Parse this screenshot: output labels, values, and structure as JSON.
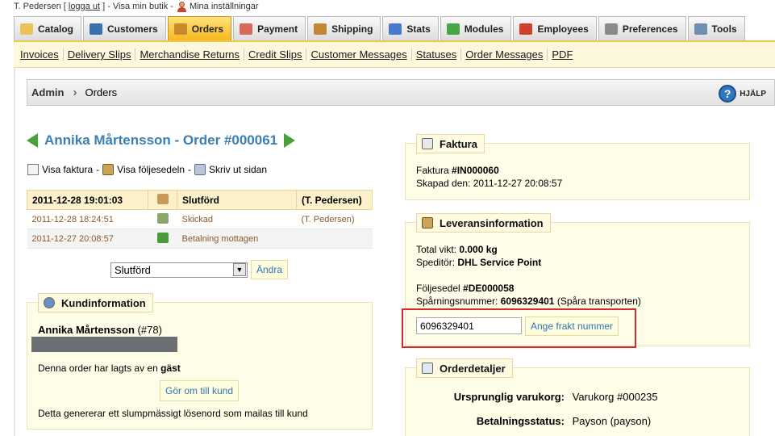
{
  "topbar": {
    "user": "T. Pedersen",
    "logout_label": "logga ut",
    "view_shop": "Visa min butik",
    "settings": "Mina inställningar"
  },
  "tabs": [
    {
      "label": "Catalog",
      "icon": "folder-icon",
      "color": "#e9c35a"
    },
    {
      "label": "Customers",
      "icon": "customers-icon",
      "color": "#3a6fb0"
    },
    {
      "label": "Orders",
      "icon": "cart-icon",
      "color": "#c88a2a",
      "active": true
    },
    {
      "label": "Payment",
      "icon": "payment-icon",
      "color": "#d9685a"
    },
    {
      "label": "Shipping",
      "icon": "truck-icon",
      "color": "#c0893a"
    },
    {
      "label": "Stats",
      "icon": "stats-icon",
      "color": "#4a7ad0"
    },
    {
      "label": "Modules",
      "icon": "puzzle-icon",
      "color": "#45a845"
    },
    {
      "label": "Employees",
      "icon": "employee-icon",
      "color": "#d04030"
    },
    {
      "label": "Preferences",
      "icon": "preferences-icon",
      "color": "#8a8a8a"
    },
    {
      "label": "Tools",
      "icon": "wrench-icon",
      "color": "#6f8fb3"
    }
  ],
  "subnav": [
    "Invoices",
    "Delivery Slips",
    "Merchandise Returns",
    "Credit Slips",
    "Customer Messages",
    "Statuses",
    "Order Messages",
    "PDF"
  ],
  "breadcrumb": {
    "root": "Admin",
    "current": "Orders",
    "help": "HJÄLP"
  },
  "order": {
    "title": "Annika Mårtensson - Order #000061",
    "actions": [
      "Visa faktura",
      "Visa följesedeln",
      "Skriv ut sidan"
    ]
  },
  "history": [
    {
      "date": "2011-12-28 19:01:03",
      "status": "Slutförd",
      "employee": "(T. Pedersen)",
      "icon": "invoice-icon",
      "icon_color": "#c99a55"
    },
    {
      "date": "2011-12-28 18:24:51",
      "status": "Skickad",
      "employee": "(T. Pedersen)",
      "icon": "truck-icon",
      "icon_color": "#8aa86a"
    },
    {
      "date": "2011-12-27 20:08:57",
      "status": "Betalning mottagen",
      "employee": "",
      "icon": "check-icon",
      "icon_color": "#4a9a3a"
    }
  ],
  "status_form": {
    "selected": "Slutförd",
    "button": "Ändra"
  },
  "customer": {
    "legend": "Kundinformation",
    "name": "Annika Mårtensson",
    "id": "(#78)",
    "guest_text": "Denna order har lagts av en",
    "guest_word": "gäst",
    "convert_button": "Gör om till kund",
    "note": "Detta genererar ett slumpmässigt lösenord som mailas till kund"
  },
  "invoice": {
    "legend": "Faktura",
    "label": "Faktura",
    "number": "#IN000060",
    "created_label": "Skapad den:",
    "created": "2011-12-27 20:08:57"
  },
  "shipping": {
    "legend": "Leveransinformation",
    "weight_label": "Total vikt:",
    "weight": "0.000 kg",
    "carrier_label": "Speditör:",
    "carrier": "DHL Service Point",
    "slip_label": "Följesedel",
    "slip": "#DE000058",
    "tracking_label": "Spårningsnummer:",
    "tracking": "6096329401",
    "tracking_link": "(Spåra transporten)",
    "tracking_input": "6096329401",
    "tracking_button": "Ange frakt nummer"
  },
  "details": {
    "legend": "Orderdetaljer",
    "rows": [
      {
        "label": "Ursprunglig varukorg:",
        "value": "Varukorg #000235"
      },
      {
        "label": "Betalningsstatus:",
        "value": "Payson (payson)"
      }
    ]
  }
}
